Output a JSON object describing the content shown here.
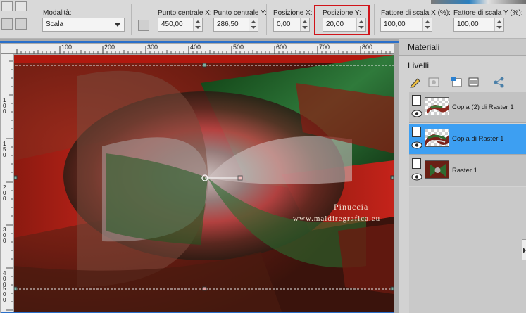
{
  "toolbar": {
    "mode_label": "Modalità:",
    "mode_value": "Scala",
    "center_x_label": "Punto centrale X:",
    "center_x_value": "450,00",
    "center_y_label": "Punto centrale Y:",
    "center_y_value": "286,50",
    "pos_x_label": "Posizione X:",
    "pos_x_value": "0,00",
    "pos_y_label": "Posizione Y:",
    "pos_y_value": "20,00",
    "scale_x_label": "Fattore di scala X (%):",
    "scale_x_value": "100,00",
    "scale_y_label": "Fattore di scala Y (%):",
    "scale_y_value": "100,00"
  },
  "ruler": {
    "top_labels": [
      "100",
      "200",
      "300",
      "400",
      "500",
      "600",
      "700",
      "800"
    ],
    "left_labels": [
      "1\n0\n0",
      "1\n5\n0",
      "2\n0\n0",
      "3\n0\n0",
      "4\n0\n0",
      "5\n0\n0"
    ]
  },
  "watermark": {
    "line1": "Pinuccia",
    "line2": "www.maldiregrafica.eu"
  },
  "panels": {
    "materials_title": "Materiali",
    "layers_title": "Livelli"
  },
  "layers": [
    {
      "name": "Copia (2) di Raster 1",
      "selected": false
    },
    {
      "name": "Copia di Raster 1",
      "selected": true
    },
    {
      "name": "Raster 1",
      "selected": false
    }
  ],
  "colors": {
    "highlight": "#d0141a",
    "selection": "#3d9ff2",
    "red": "#b01b12",
    "green": "#1f5a22"
  }
}
